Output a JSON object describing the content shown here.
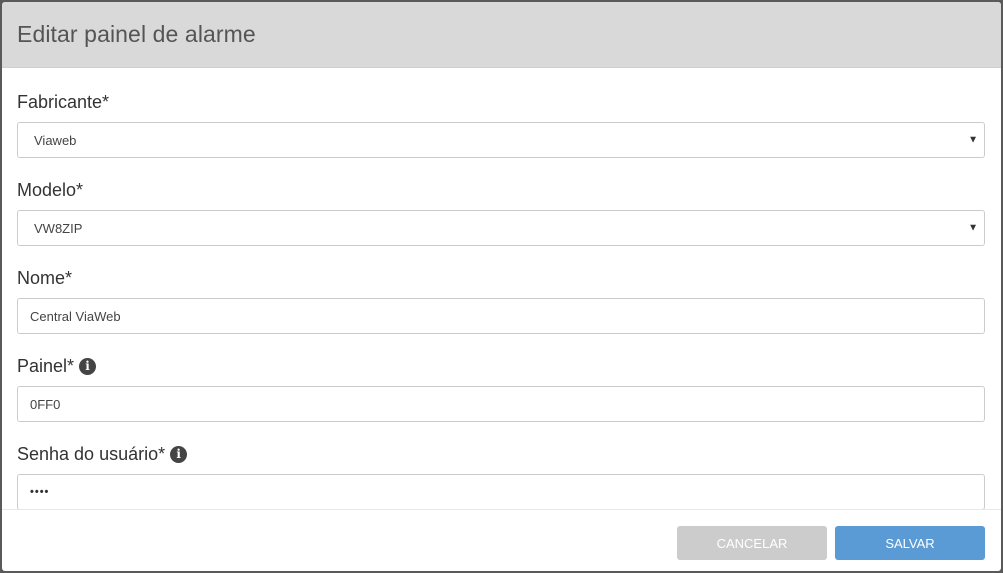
{
  "modal": {
    "title": "Editar painel de alarme"
  },
  "form": {
    "fabricante": {
      "label": "Fabricante*",
      "value": "Viaweb"
    },
    "modelo": {
      "label": "Modelo*",
      "value": "VW8ZIP"
    },
    "nome": {
      "label": "Nome*",
      "value": "Central ViaWeb"
    },
    "painel": {
      "label": "Painel*",
      "value": "0FF0"
    },
    "senha": {
      "label": "Senha do usuário*",
      "value": "••••"
    }
  },
  "footer": {
    "cancel_label": "CANCELAR",
    "save_label": "SALVAR"
  },
  "icons": {
    "info": "info-circle-icon",
    "caret": "caret-down-icon"
  },
  "colors": {
    "header_bg": "#d9d9d9",
    "save_button": "#5b9bd5",
    "cancel_button": "#cccccc"
  }
}
